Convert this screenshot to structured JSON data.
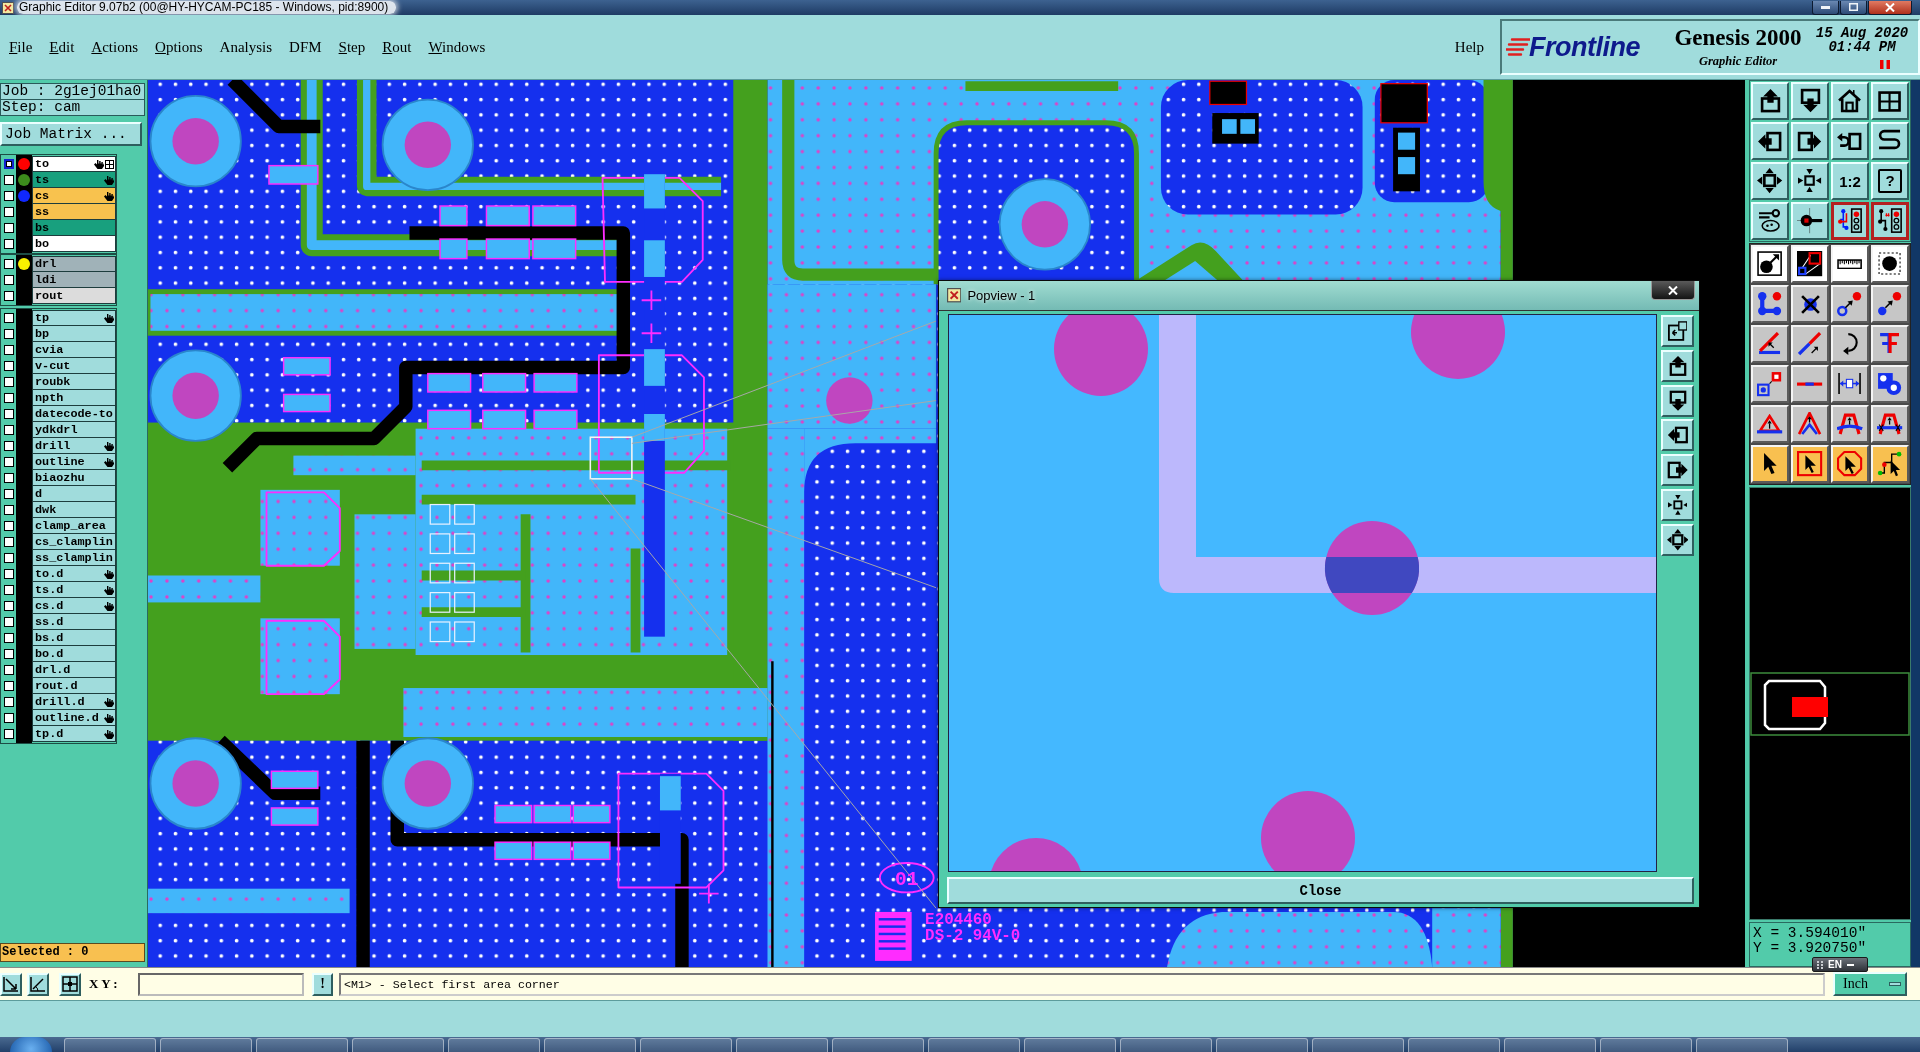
{
  "window": {
    "title": "Graphic Editor 9.07b2 (00@HY-HYCAM-PC185 - Windows, pid:8900)"
  },
  "menu": {
    "items": [
      {
        "label": "File",
        "underlined": true
      },
      {
        "label": "Edit",
        "underlined": true
      },
      {
        "label": "Actions",
        "underlined": true
      },
      {
        "label": "Options",
        "underlined": true
      },
      {
        "label": "Analysis",
        "underlined": false
      },
      {
        "label": "DFM",
        "underlined": false
      },
      {
        "label": "Step",
        "underlined": true
      },
      {
        "label": "Rout",
        "underlined": true
      },
      {
        "label": "Windows",
        "underlined": true
      }
    ],
    "help": {
      "label": "Help",
      "underlined": false
    }
  },
  "brand": {
    "logo": "Frontline",
    "product": "Genesis 2000",
    "module": "Graphic Editor",
    "date": "15 Aug 2020",
    "time": "01:44 PM"
  },
  "job_panel": {
    "job": "Job : 2g1ej01ha0",
    "step": "Step: cam",
    "matrix_button": "Job Matrix ..."
  },
  "layer_groups": [
    {
      "layers": [
        {
          "name": "to",
          "color": "#ffffff",
          "dot": {
            "color": "#ff0000"
          },
          "selected": true,
          "affected": true,
          "work_layer": true
        },
        {
          "name": "ts",
          "color": "#18a07e",
          "dot": {
            "color": "#3c8c1c"
          },
          "selected": false,
          "affected": true,
          "work_layer": false
        },
        {
          "name": "cs",
          "color": "#f8c24e",
          "dot": {
            "color": "#1028ff"
          },
          "selected": false,
          "affected": true,
          "work_layer": false
        },
        {
          "name": "ss",
          "color": "#f8c24e",
          "selected": false,
          "affected": false,
          "work_layer": false
        },
        {
          "name": "bs",
          "color": "#18a07e",
          "selected": false,
          "affected": false,
          "work_layer": false
        },
        {
          "name": "bo",
          "color": "#ffffff",
          "selected": false,
          "affected": false,
          "work_layer": false
        }
      ]
    },
    {
      "layers": [
        {
          "name": "drl",
          "color": "#a0b2b8",
          "dot": {
            "color": "#f8f000"
          },
          "selected": false,
          "affected": false,
          "work_layer": false
        },
        {
          "name": "ldi",
          "color": "#a0b2b8",
          "selected": false,
          "affected": false,
          "work_layer": false
        },
        {
          "name": "rout",
          "color": "#dcdcdc",
          "selected": false,
          "affected": false,
          "work_layer": false
        }
      ]
    },
    {
      "layers": [
        {
          "name": "tp",
          "color": "#a0dcdc",
          "selected": false,
          "affected": true,
          "work_layer": false
        },
        {
          "name": "bp",
          "color": "#a0dcdc",
          "selected": false,
          "affected": false,
          "work_layer": false
        },
        {
          "name": "cvia",
          "color": "#a0dcdc",
          "selected": false,
          "affected": false,
          "work_layer": false
        },
        {
          "name": "v-cut",
          "color": "#a0dcdc",
          "selected": false,
          "affected": false,
          "work_layer": false
        },
        {
          "name": "roubk",
          "color": "#a0dcdc",
          "selected": false,
          "affected": false,
          "work_layer": false
        },
        {
          "name": "npth",
          "color": "#a0dcdc",
          "selected": false,
          "affected": false,
          "work_layer": false
        },
        {
          "name": "datecode-to",
          "color": "#a0dcdc",
          "selected": false,
          "affected": false,
          "work_layer": false
        },
        {
          "name": "ydkdrl",
          "color": "#a0dcdc",
          "selected": false,
          "affected": false,
          "work_layer": false
        },
        {
          "name": "drill",
          "color": "#a0dcdc",
          "selected": false,
          "affected": true,
          "work_layer": false
        },
        {
          "name": "outline",
          "color": "#a0dcdc",
          "selected": false,
          "affected": true,
          "work_layer": false
        },
        {
          "name": "biaozhu",
          "color": "#a0dcdc",
          "selected": false,
          "affected": false,
          "work_layer": false
        },
        {
          "name": "d",
          "color": "#a0dcdc",
          "selected": false,
          "affected": false,
          "work_layer": false
        },
        {
          "name": "dwk",
          "color": "#a0dcdc",
          "selected": false,
          "affected": false,
          "work_layer": false
        },
        {
          "name": "clamp_area",
          "color": "#a0dcdc",
          "selected": false,
          "affected": false,
          "work_layer": false
        },
        {
          "name": "cs_clamplin",
          "color": "#a0dcdc",
          "selected": false,
          "affected": false,
          "work_layer": false
        },
        {
          "name": "ss_clamplin",
          "color": "#a0dcdc",
          "selected": false,
          "affected": false,
          "work_layer": false
        },
        {
          "name": "to.d",
          "color": "#a0dcdc",
          "selected": false,
          "affected": true,
          "work_layer": false
        },
        {
          "name": "ts.d",
          "color": "#a0dcdc",
          "selected": false,
          "affected": true,
          "work_layer": false
        },
        {
          "name": "cs.d",
          "color": "#a0dcdc",
          "selected": false,
          "affected": true,
          "work_layer": false
        },
        {
          "name": "ss.d",
          "color": "#a0dcdc",
          "selected": false,
          "affected": false,
          "work_layer": false
        },
        {
          "name": "bs.d",
          "color": "#a0dcdc",
          "selected": false,
          "affected": false,
          "work_layer": false
        },
        {
          "name": "bo.d",
          "color": "#a0dcdc",
          "selected": false,
          "affected": false,
          "work_layer": false
        },
        {
          "name": "drl.d",
          "color": "#a0dcdc",
          "selected": false,
          "affected": false,
          "work_layer": false
        },
        {
          "name": "rout.d",
          "color": "#a0dcdc",
          "selected": false,
          "affected": false,
          "work_layer": false
        },
        {
          "name": "drill.d",
          "color": "#a0dcdc",
          "selected": false,
          "affected": true,
          "work_layer": false
        },
        {
          "name": "outline.d",
          "color": "#a0dcdc",
          "selected": false,
          "affected": true,
          "work_layer": false
        },
        {
          "name": "tp.d",
          "color": "#a0dcdc",
          "selected": false,
          "affected": true,
          "work_layer": false
        }
      ]
    }
  ],
  "selection_status": "Selected : 0",
  "canvas": {
    "silkscreen": [
      "01",
      "E204460",
      "DS-2 94V-0"
    ]
  },
  "popview": {
    "title": "Popview - 1",
    "close_button": "Close"
  },
  "tool_palette": {
    "buttons": [
      {
        "kind": "icon",
        "on": false
      },
      {
        "kind": "icon",
        "on": false
      },
      {
        "kind": "icon",
        "on": false
      },
      {
        "kind": "icon",
        "on": false
      },
      {
        "kind": "icon",
        "on": false
      },
      {
        "kind": "icon",
        "on": false
      },
      {
        "kind": "icon",
        "on": false
      },
      {
        "kind": "icon",
        "on": false
      },
      {
        "kind": "icon",
        "on": false
      },
      {
        "kind": "icon",
        "on": false
      },
      {
        "kind": "text",
        "label": "1:2",
        "on": false
      },
      {
        "kind": "boxed_text",
        "label": "?",
        "on": false
      },
      {
        "kind": "icon",
        "on": false
      },
      {
        "kind": "icon",
        "on": false
      },
      {
        "kind": "icon",
        "on": true
      },
      {
        "kind": "icon",
        "on": true
      }
    ]
  },
  "coordinates": {
    "x": "X = 3.594010\"",
    "y": "Y = 3.920750\""
  },
  "language_bar": {
    "label": "EN"
  },
  "command_bar": {
    "xy_label": "X Y :",
    "confirm_button": "!",
    "message": "<M1> - Select first area corner",
    "units": "Inch"
  }
}
